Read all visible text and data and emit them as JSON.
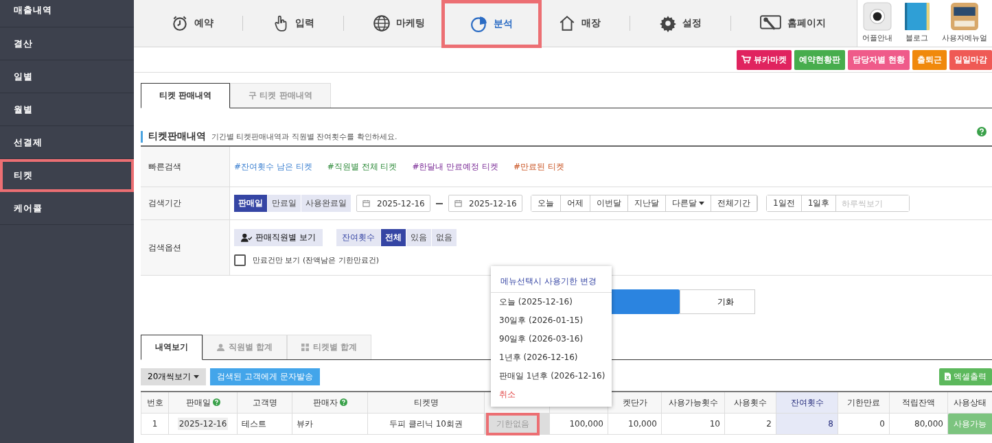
{
  "sidebar": {
    "items": [
      {
        "label": "매출내역",
        "highlighted": false
      },
      {
        "label": "결산",
        "highlighted": false
      },
      {
        "label": "일별",
        "highlighted": false
      },
      {
        "label": "월별",
        "highlighted": false
      },
      {
        "label": "선결제",
        "highlighted": false
      },
      {
        "label": "티켓",
        "highlighted": true
      },
      {
        "label": "케어콜",
        "highlighted": false
      }
    ]
  },
  "nav": {
    "items": [
      {
        "label": "예약",
        "selected": false,
        "highlighted": false
      },
      {
        "label": "입력",
        "selected": false,
        "highlighted": false
      },
      {
        "label": "마케팅",
        "selected": false,
        "highlighted": false
      },
      {
        "label": "분석",
        "selected": true,
        "highlighted": true
      },
      {
        "label": "매장",
        "selected": false,
        "highlighted": false
      },
      {
        "label": "설정",
        "selected": false,
        "highlighted": false
      },
      {
        "label": "홈페이지",
        "selected": false,
        "highlighted": false
      }
    ],
    "apps": [
      {
        "label": "어플안내"
      },
      {
        "label": "블로그"
      },
      {
        "label": "사용자메뉴얼"
      }
    ]
  },
  "action_buttons": [
    {
      "label": "뷰카마켓",
      "color": "#e0235f",
      "cart": true
    },
    {
      "label": "예약현황판",
      "color": "#47ad4d",
      "cart": false
    },
    {
      "label": "담당자별 현황",
      "color": "#ef5b8a",
      "cart": false
    },
    {
      "label": "출퇴근",
      "color": "#f0890c",
      "cart": false
    },
    {
      "label": "일일마감",
      "color": "#ef5a55",
      "cart": false
    }
  ],
  "tabs": [
    {
      "label": "티켓 판매내역",
      "selected": true
    },
    {
      "label": "구 티켓 판매내역",
      "selected": false
    }
  ],
  "section": {
    "title": "티켓판매내역",
    "description": "기간별 티켓판매내역과 직원별 잔여횟수를 확인하세요."
  },
  "quick_search": {
    "label": "빠른검색",
    "links": [
      {
        "label": "#잔여횟수 남은 티켓",
        "color": "#3a7fd0"
      },
      {
        "label": "#직원별 전체 티켓",
        "color": "#2e8b3a"
      },
      {
        "label": "#한달내 만료예정 티켓",
        "color": "#7a2a96"
      },
      {
        "label": "#만료된 티켓",
        "color": "#c8501e"
      }
    ]
  },
  "period": {
    "label": "검색기간",
    "date_types": [
      {
        "label": "판매일",
        "selected": true
      },
      {
        "label": "만료일",
        "selected": false
      },
      {
        "label": "사용완료일",
        "selected": false
      }
    ],
    "start": "2025-12-16",
    "end": "2025-12-16",
    "ranges": [
      {
        "label": "오늘",
        "dropdown": false
      },
      {
        "label": "어제",
        "dropdown": false
      },
      {
        "label": "이번달",
        "dropdown": false
      },
      {
        "label": "지난달",
        "dropdown": false
      },
      {
        "label": "다른달",
        "dropdown": true
      },
      {
        "label": "전체기간",
        "dropdown": false
      }
    ],
    "steps": [
      "1일전",
      "1일후"
    ],
    "day_placeholder": "하루씩보기"
  },
  "options": {
    "label": "검색옵션",
    "staff_button": "판매직원별 보기",
    "remaining_label": "잔여횟수",
    "remaining": [
      {
        "label": "전체",
        "selected": true
      },
      {
        "label": "있음",
        "selected": false
      },
      {
        "label": "없음",
        "selected": false
      }
    ],
    "expired_only": {
      "label": "만료건만 보기 (잔액남은 기한만료건)",
      "checked": false
    }
  },
  "reset_button": "기화",
  "view_tabs": [
    {
      "label": "내역보기",
      "selected": true
    },
    {
      "label": "직원별 합계",
      "selected": false
    },
    {
      "label": "티켓별 합계",
      "selected": false
    }
  ],
  "page_size": "20개씩보기",
  "sms_button": "검색된 고객에게 문자발송",
  "excel_button": "엑셀출력",
  "table": {
    "columns": [
      {
        "label": "번호",
        "help": false,
        "highlighted": false
      },
      {
        "label": "판매일",
        "help": true,
        "highlighted": false
      },
      {
        "label": "고객명",
        "help": false,
        "highlighted": false
      },
      {
        "label": "판매자",
        "help": true,
        "highlighted": false
      },
      {
        "label": "티켓명",
        "help": false,
        "highlighted": false
      },
      {
        "highlighted": false
      },
      {
        "highlighted": false
      },
      {
        "label": "켓단가",
        "help": false,
        "highlighted": false
      },
      {
        "label": "사용가능횟수",
        "help": false,
        "highlighted": false
      },
      {
        "label": "사용횟수",
        "help": false,
        "highlighted": false
      },
      {
        "label": "잔여횟수",
        "help": false,
        "highlighted": true
      },
      {
        "label": "기한만료",
        "help": false,
        "highlighted": false
      },
      {
        "label": "적립잔액",
        "help": false,
        "highlighted": false
      },
      {
        "label": "사용상태",
        "help": false,
        "highlighted": false
      }
    ],
    "rows": [
      {
        "cells": [
          {
            "text": "1",
            "kind": "center"
          },
          {
            "text": "2025-12-16",
            "kind": "date"
          },
          {
            "text": "테스트",
            "kind": "left"
          },
          {
            "text": "뷰카",
            "kind": "left"
          },
          {
            "text": "두피 클리닉 10회권",
            "kind": "center"
          },
          {
            "text": "기한없음",
            "kind": "chip",
            "marked": true
          },
          {
            "text": "100,000",
            "kind": "num"
          },
          {
            "text": "10,000",
            "kind": "num"
          },
          {
            "text": "10",
            "kind": "num"
          },
          {
            "text": "2",
            "kind": "num"
          },
          {
            "text": "8",
            "kind": "num"
          },
          {
            "text": "0",
            "kind": "num"
          },
          {
            "text": "80,000",
            "kind": "num"
          },
          {
            "text": "사용가능",
            "kind": "status"
          }
        ]
      }
    ]
  },
  "popup": {
    "title": "메뉴선택시 사용기한 변경",
    "options": [
      {
        "label": "오늘 (2025-12-16)",
        "kind": "option"
      },
      {
        "label": "30일후 (2026-01-15)",
        "kind": "option"
      },
      {
        "label": "90일후 (2026-03-16)",
        "kind": "option"
      },
      {
        "label": "1년후 (2026-12-16)",
        "kind": "option"
      },
      {
        "label": "판매일 1년후 (2026-12-16)",
        "kind": "option"
      },
      {
        "label": "취소",
        "kind": "cancel"
      }
    ]
  }
}
